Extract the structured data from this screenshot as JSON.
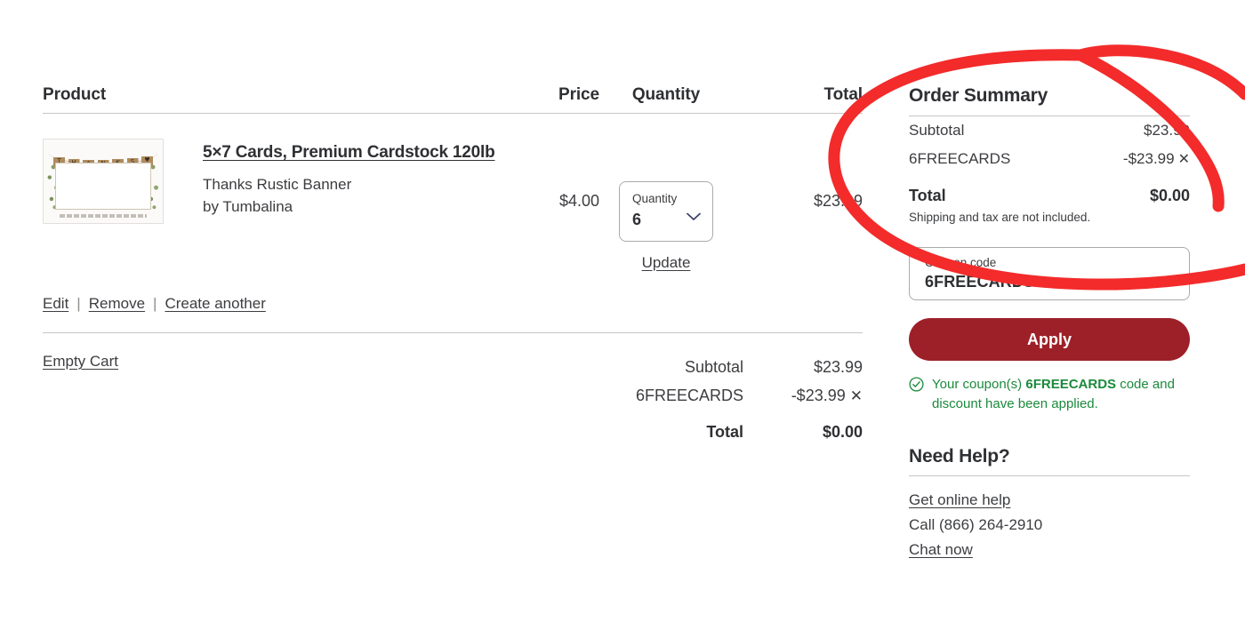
{
  "cart_table": {
    "columns": [
      "Product",
      "Price",
      "Quantity",
      "Total"
    ],
    "item": {
      "title": "5×7 Cards, Premium Cardstock 120lb",
      "design_name": "Thanks Rustic Banner",
      "designer": "by Tumbalina",
      "price": "$4.00",
      "quantity_label": "Quantity",
      "quantity_value": "6",
      "line_total": "$23.99",
      "update_label": "Update",
      "thumbnail_alt": "Thanks Rustic Banner card thumbnail",
      "thumbnail_banner_letters": [
        "T",
        "H",
        "A",
        "N",
        "K",
        "S",
        "♥"
      ],
      "actions": [
        "Edit",
        "Remove",
        "Create another"
      ],
      "action_separator": "|"
    },
    "empty_cart_label": "Empty Cart",
    "totals": [
      {
        "label": "Subtotal",
        "amount": "$23.99",
        "removable": false
      },
      {
        "label": "6FREECARDS",
        "amount": "-$23.99",
        "removable": true
      },
      {
        "label": "Total",
        "amount": "$0.00",
        "removable": false
      }
    ],
    "remove_glyph": "✕"
  },
  "order_summary": {
    "title": "Order Summary",
    "rows": [
      {
        "label": "Subtotal",
        "amount": "$23.99",
        "removable": false
      },
      {
        "label": "6FREECARDS",
        "amount": "-$23.99",
        "removable": true
      }
    ],
    "total_label": "Total",
    "total_amount": "$0.00",
    "note": "Shipping and tax are not included.",
    "remove_glyph": "✕"
  },
  "coupon": {
    "label": "Coupon code",
    "value": "6FREECARDS",
    "placeholder": "Coupon code",
    "apply_label": "Apply",
    "success_prefix": "Your coupon(s)",
    "success_code": "6FREECARDS",
    "success_suffix": "code and discount have been applied.",
    "success_icon": "check-circle-icon"
  },
  "need_help": {
    "title": "Need Help?",
    "online_help": "Get online help",
    "phone": "Call (866) 264-2910",
    "chat": "Chat now"
  },
  "annotation": {
    "type": "hand-drawn-ellipse",
    "color": "#F32B2B",
    "targets": "order-summary-panel"
  },
  "colors": {
    "text": "#3C3D40",
    "heading": "#2F3033",
    "rule": "#C9C6C4",
    "apply_button": "#9D2029",
    "success_green": "#1B8A3C",
    "annotation_red": "#F32B2B",
    "chevron": "#3A3E66"
  }
}
